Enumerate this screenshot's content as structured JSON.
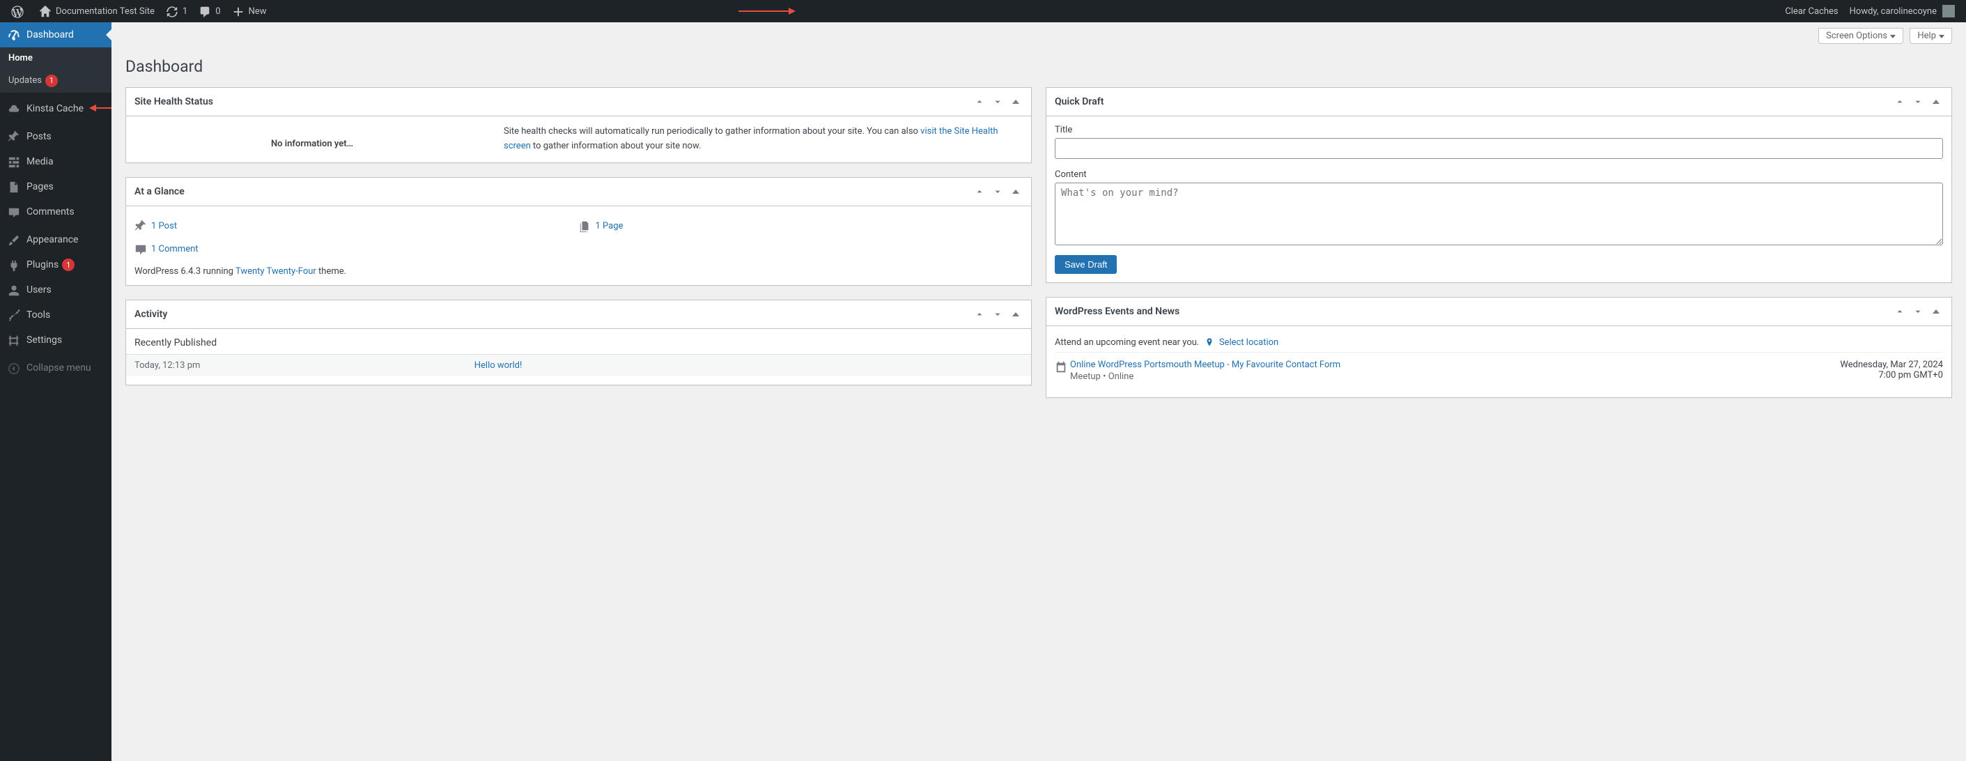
{
  "adminbar": {
    "site_name": "Documentation Test Site",
    "refresh_count": "1",
    "comment_count": "0",
    "new_label": "New",
    "clear_caches": "Clear Caches",
    "howdy": "Howdy, carolinecoyne"
  },
  "screen_meta": {
    "screen_options": "Screen Options",
    "help": "Help"
  },
  "page_title": "Dashboard",
  "menu": {
    "dashboard": "Dashboard",
    "home": "Home",
    "updates": "Updates",
    "updates_count": "1",
    "kinsta_cache": "Kinsta Cache",
    "posts": "Posts",
    "media": "Media",
    "pages": "Pages",
    "comments": "Comments",
    "appearance": "Appearance",
    "plugins": "Plugins",
    "plugins_count": "1",
    "users": "Users",
    "tools": "Tools",
    "settings": "Settings",
    "collapse": "Collapse menu"
  },
  "site_health": {
    "title": "Site Health Status",
    "no_info": "No information yet…",
    "text_before": "Site health checks will automatically run periodically to gather information about your site. You can also ",
    "link": "visit the Site Health screen",
    "text_after": " to gather information about your site now."
  },
  "glance": {
    "title": "At a Glance",
    "posts": "1 Post",
    "pages": "1 Page",
    "comments": "1 Comment",
    "wp_text_pre": "WordPress 6.4.3 running ",
    "theme_link": "Twenty Twenty-Four",
    "wp_text_post": " theme."
  },
  "activity": {
    "title": "Activity",
    "section": "Recently Published",
    "row_time": "Today, 12:13 pm",
    "row_link": "Hello world!"
  },
  "quickdraft": {
    "title": "Quick Draft",
    "title_label": "Title",
    "content_label": "Content",
    "placeholder": "What's on your mind?",
    "save": "Save Draft"
  },
  "events": {
    "title": "WordPress Events and News",
    "near_text": "Attend an upcoming event near you.",
    "select_location": "Select location",
    "item": {
      "title": "Online WordPress Portsmouth Meetup - My Favourite Contact Form",
      "meta": "Meetup • Online",
      "date": "Wednesday, Mar 27, 2024",
      "time": "7:00 pm GMT+0"
    }
  }
}
